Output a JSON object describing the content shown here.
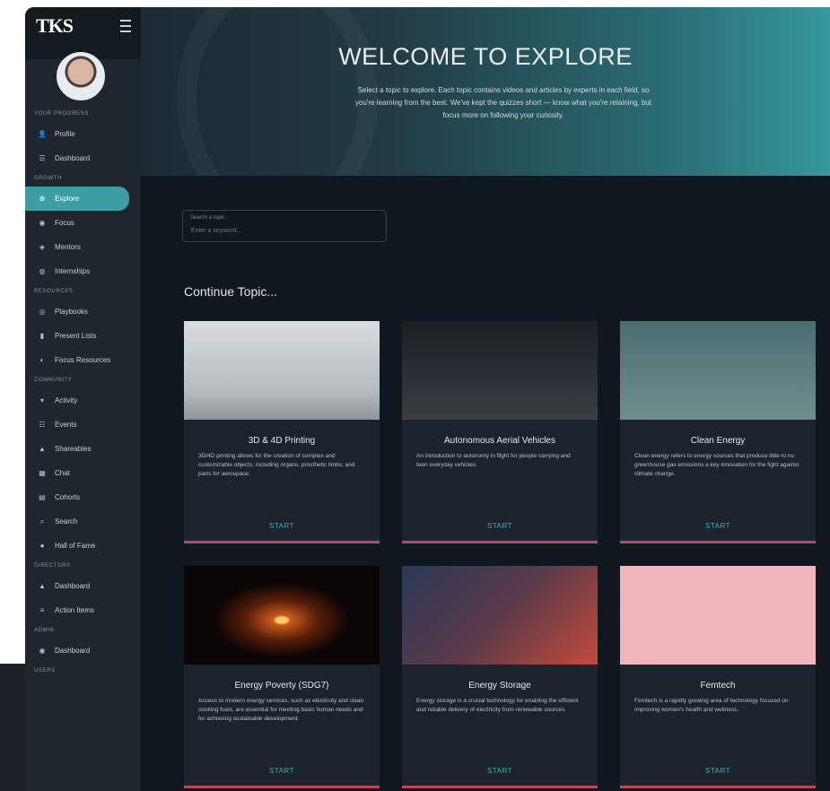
{
  "app": {
    "logo": "TKS"
  },
  "sidebar": {
    "sections": [
      {
        "label": "YOUR PROGRESS",
        "items": [
          {
            "label": "Profile",
            "icon": "person-icon",
            "glyph": "👤"
          },
          {
            "label": "Dashboard",
            "icon": "dashboard-icon",
            "glyph": "☰"
          }
        ]
      },
      {
        "label": "GROWTH",
        "items": [
          {
            "label": "Explore",
            "icon": "compass-icon",
            "glyph": "⊕",
            "active": true
          },
          {
            "label": "Focus",
            "icon": "target-icon",
            "glyph": "◉"
          },
          {
            "label": "Mentors",
            "icon": "mentor-icon",
            "glyph": "◈"
          },
          {
            "label": "Internships",
            "icon": "briefcase-icon",
            "glyph": "◍"
          }
        ]
      },
      {
        "label": "RESOURCES",
        "items": [
          {
            "label": "Playbooks",
            "icon": "book-icon",
            "glyph": "◎"
          },
          {
            "label": "Present Lists",
            "icon": "pin-icon",
            "glyph": "▮"
          },
          {
            "label": "Focus Resources",
            "icon": "folder-icon",
            "glyph": "◐"
          }
        ]
      },
      {
        "label": "COMMUNITY",
        "items": [
          {
            "label": "Activity",
            "icon": "activity-icon",
            "glyph": "▾"
          },
          {
            "label": "Events",
            "icon": "calendar-icon",
            "glyph": "☷"
          },
          {
            "label": "Shareables",
            "icon": "share-icon",
            "glyph": "▲"
          },
          {
            "label": "Chat",
            "icon": "chat-icon",
            "glyph": "▦"
          },
          {
            "label": "Cohorts",
            "icon": "group-icon",
            "glyph": "▤"
          },
          {
            "label": "Search",
            "icon": "search-icon",
            "glyph": "⌕"
          },
          {
            "label": "Hall of Fame",
            "icon": "trophy-icon",
            "glyph": "●"
          }
        ]
      },
      {
        "label": "DIRECTORS",
        "items": [
          {
            "label": "Dashboard",
            "icon": "dashboard-icon",
            "glyph": "▲"
          },
          {
            "label": "Action Items",
            "icon": "checklist-icon",
            "glyph": "≡"
          }
        ]
      },
      {
        "label": "ADMIN",
        "items": [
          {
            "label": "Dashboard",
            "icon": "dashboard-icon",
            "glyph": "◉"
          }
        ]
      },
      {
        "label": "USERS",
        "items": []
      }
    ]
  },
  "hero": {
    "title": "WELCOME TO EXPLORE",
    "subtitle": "Select a topic to explore. Each topic contains videos and articles by experts in each field, so you're learning from the best. We've kept the quizzes short — know what you're retaining, but focus more on following your curiosity."
  },
  "search": {
    "label": "Search a topic",
    "placeholder": "Enter a keyword..."
  },
  "continue_heading": "Continue Topic...",
  "cards": [
    {
      "title": "3D & 4D Printing",
      "desc": "3D/4D printing allows for the creation of complex and customizable objects, including organs, prosthetic limbs, and parts for aerospace.",
      "cta": "START",
      "image": "printing"
    },
    {
      "title": "Autonomous Aerial Vehicles",
      "desc": "An introduction to autonomy in flight for people carrying and teen everyday vehicles.",
      "cta": "START",
      "image": "drone"
    },
    {
      "title": "Clean Energy",
      "desc": "Clean energy refers to energy sources that produce little to no greenhouse gas emissions a key innovation for the fight against climate change.",
      "cta": "START",
      "image": "energy"
    },
    {
      "title": "Energy Poverty (SDG7)",
      "desc": "Access to modern energy services, such as electricity and clean cooking fuels, are essential for meeting basic human needs and for achieving sustainable development.",
      "cta": "START",
      "image": "poverty"
    },
    {
      "title": "Energy Storage",
      "desc": "Energy storage is a crucial technology for enabling the efficient and reliable delivery of electricity from renewable sources.",
      "cta": "START",
      "image": "storage"
    },
    {
      "title": "Femtech",
      "desc": "Femtech is a rapidly growing area of technology focused on improving women's health and wellness.",
      "cta": "START",
      "image": "femtech"
    }
  ],
  "colors": {
    "accent": "#3d9fa3",
    "card_bar": "#b84a5c",
    "background": "#10181f",
    "sidebar": "#1f272e"
  }
}
